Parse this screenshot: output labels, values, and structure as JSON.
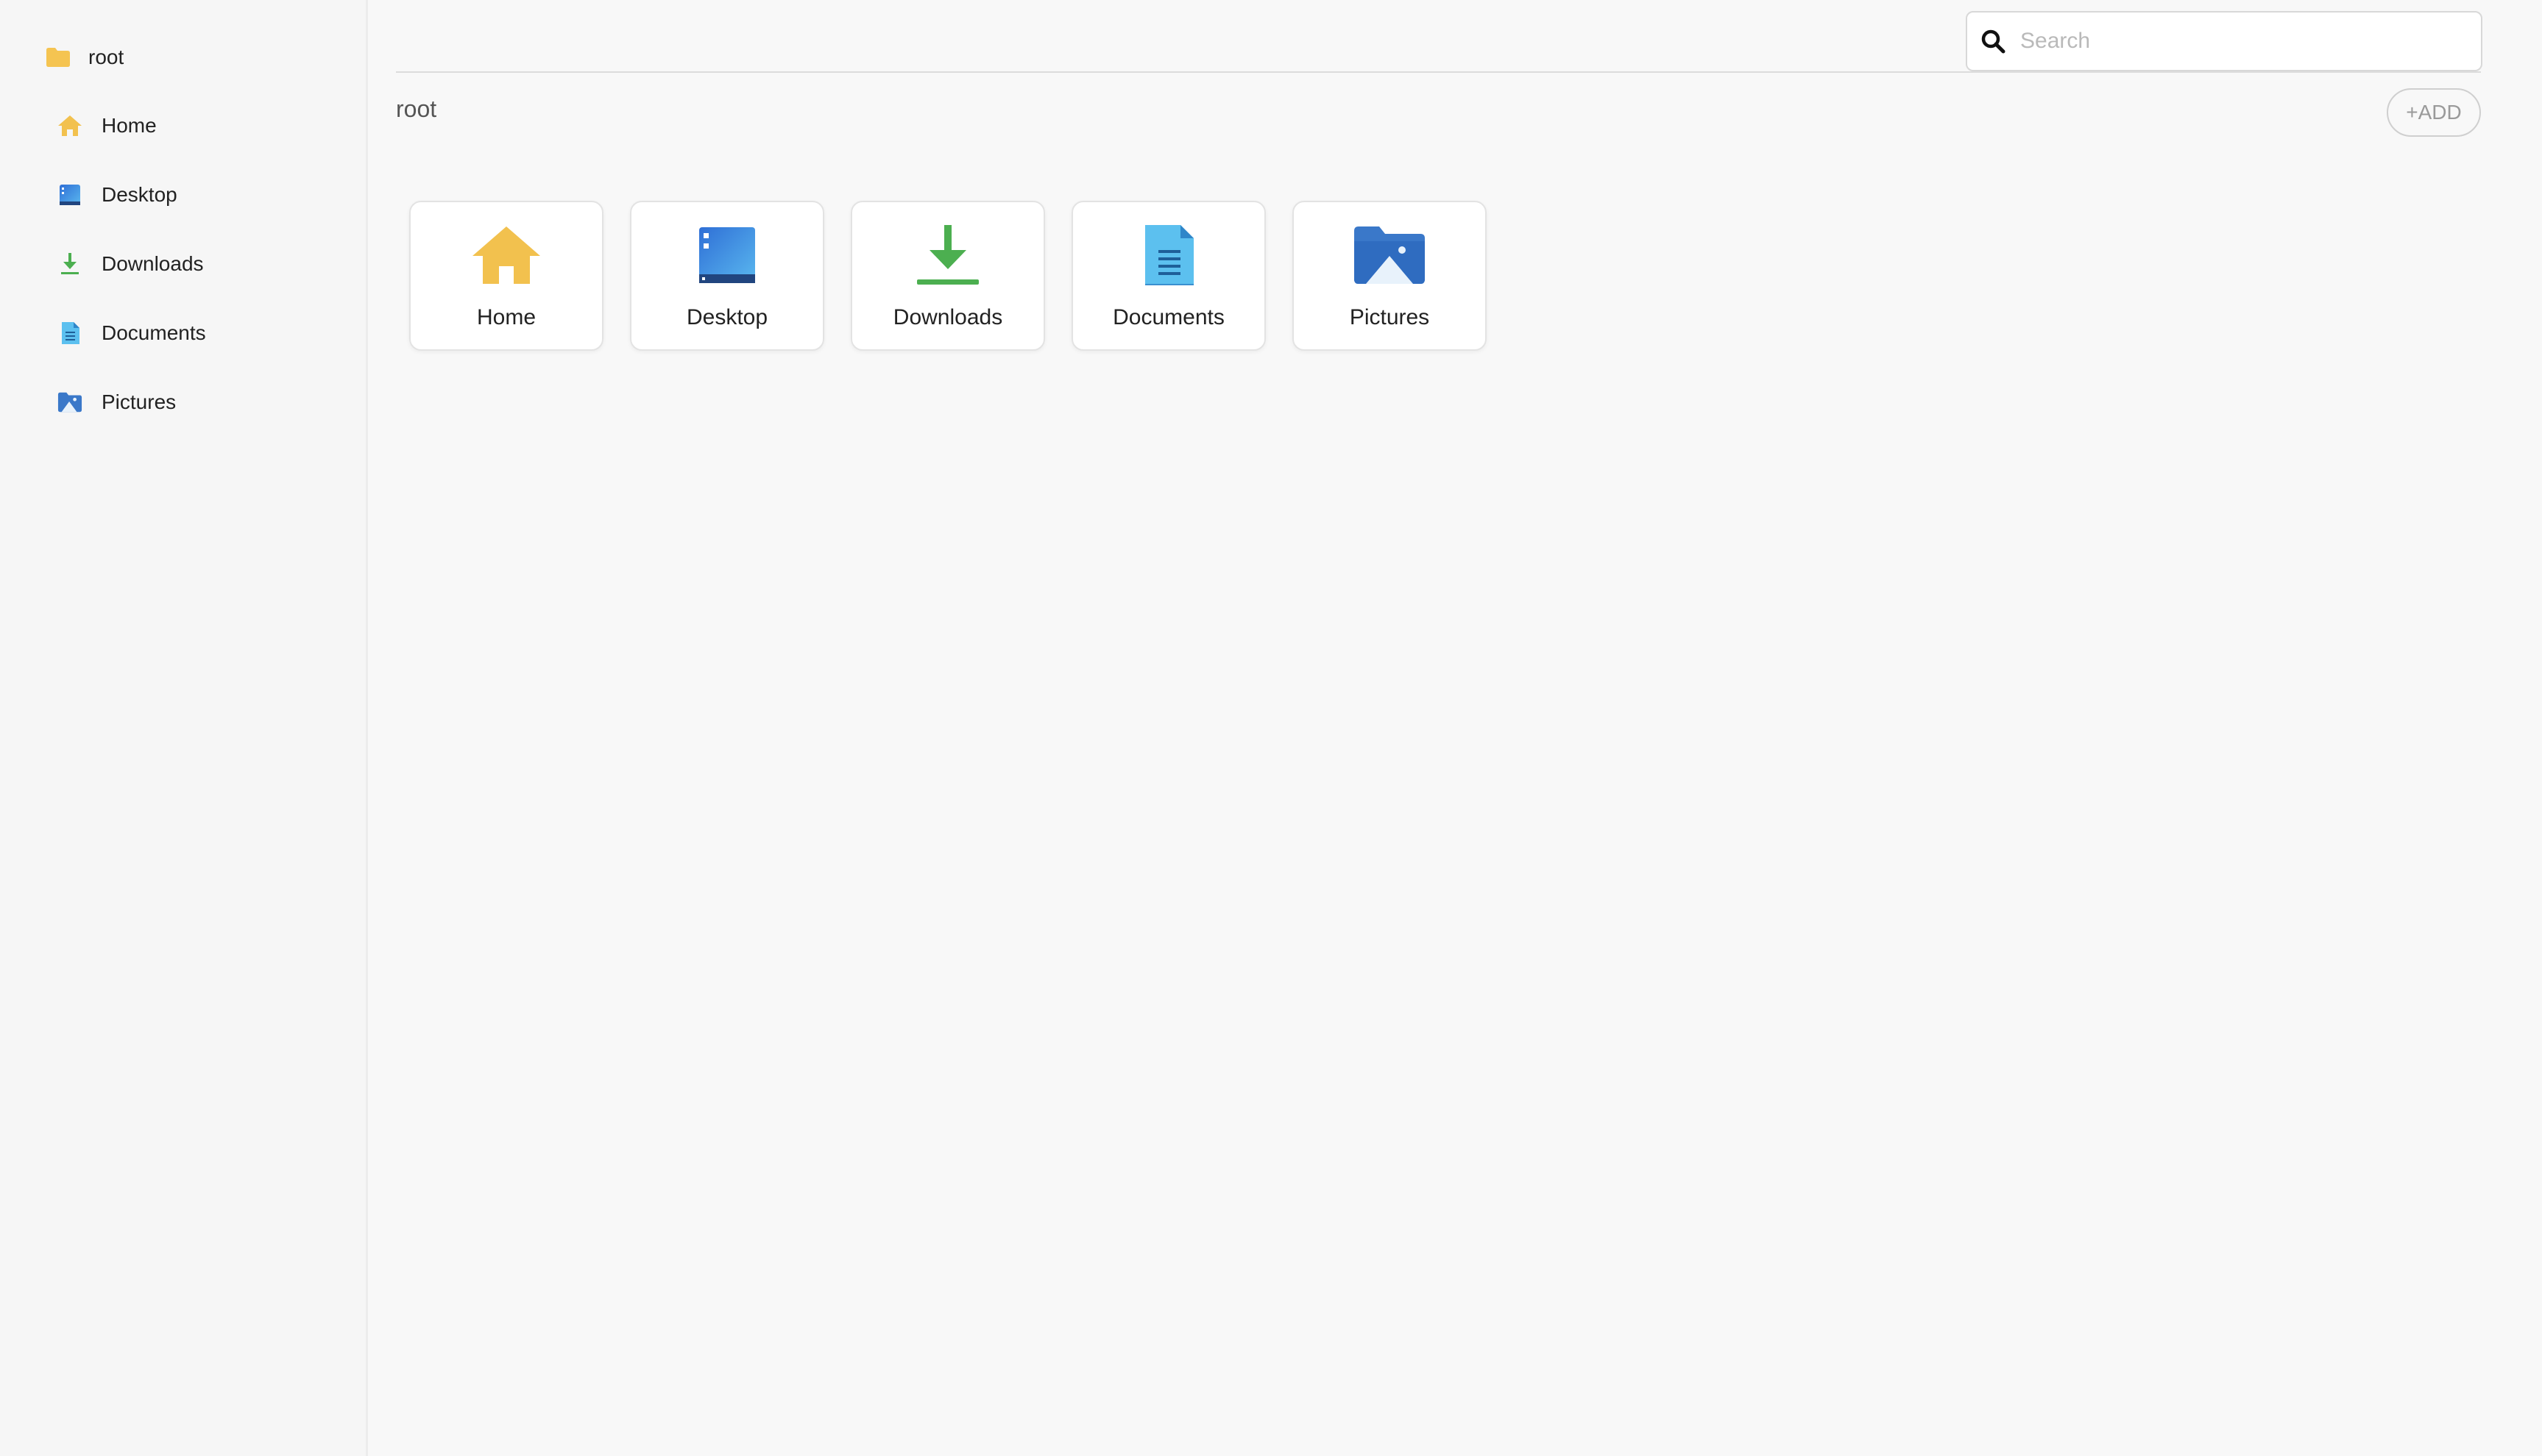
{
  "sidebar": {
    "root_label": "root",
    "items": [
      {
        "label": "Home",
        "icon": "home-icon"
      },
      {
        "label": "Desktop",
        "icon": "desktop-icon"
      },
      {
        "label": "Downloads",
        "icon": "download-icon"
      },
      {
        "label": "Documents",
        "icon": "document-icon"
      },
      {
        "label": "Pictures",
        "icon": "pictures-icon"
      }
    ]
  },
  "search": {
    "placeholder": "Search",
    "value": ""
  },
  "breadcrumb": "root",
  "add_button": "+ADD",
  "folders": [
    {
      "label": "Home",
      "icon": "home-icon"
    },
    {
      "label": "Desktop",
      "icon": "desktop-icon"
    },
    {
      "label": "Downloads",
      "icon": "download-icon"
    },
    {
      "label": "Documents",
      "icon": "document-icon"
    },
    {
      "label": "Pictures",
      "icon": "pictures-icon"
    }
  ],
  "colors": {
    "home": "#f2c14e",
    "desktop": "#3a7bd5",
    "downloads": "#4caf50",
    "documents": "#4fb3e8",
    "pictures": "#3a78c9",
    "folder": "#f5c451"
  }
}
